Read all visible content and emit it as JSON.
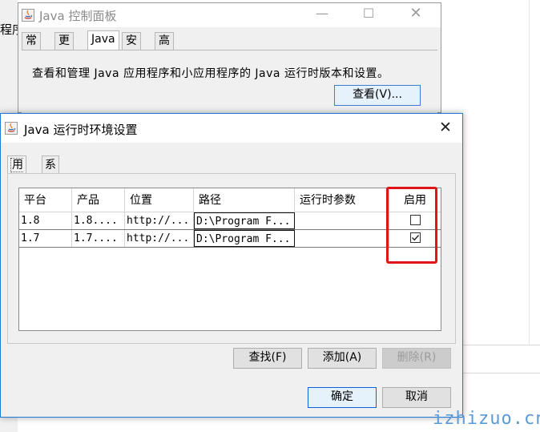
{
  "background": {
    "left_text": "程序"
  },
  "control_panel": {
    "title": "Java 控制面板",
    "tabs": [
      {
        "label": "常规"
      },
      {
        "label": "更新"
      },
      {
        "label": "Java"
      },
      {
        "label": "安全"
      },
      {
        "label": "高级"
      }
    ],
    "active_tab": "Java",
    "description": "查看和管理 Java 应用程序和小应用程序的 Java 运行时版本和设置。",
    "view_button": "查看(V)..."
  },
  "runtime_dialog": {
    "title": "Java 运行时环境设置",
    "tabs": [
      {
        "label": "用户"
      },
      {
        "label": "系统"
      }
    ],
    "active_tab": "用户",
    "table": {
      "columns": [
        "平台",
        "产品",
        "位置",
        "路径",
        "运行时参数",
        "启用"
      ],
      "rows": [
        {
          "platform": "1.8",
          "product": "1.8....",
          "location": "http://...",
          "path": "D:\\Program F...",
          "params": "",
          "enabled": false
        },
        {
          "platform": "1.7",
          "product": "1.7....",
          "location": "http://...",
          "path": "D:\\Program F...",
          "params": "",
          "enabled": true
        }
      ]
    },
    "buttons": {
      "find": "查找(F)",
      "add": "添加(A)",
      "delete": "删除(R)",
      "ok": "确定",
      "cancel": "取消"
    }
  },
  "watermark": "izhizuo.cn",
  "colors": {
    "highlight": "#e0151b",
    "accent_border": "#1e7ad6"
  }
}
